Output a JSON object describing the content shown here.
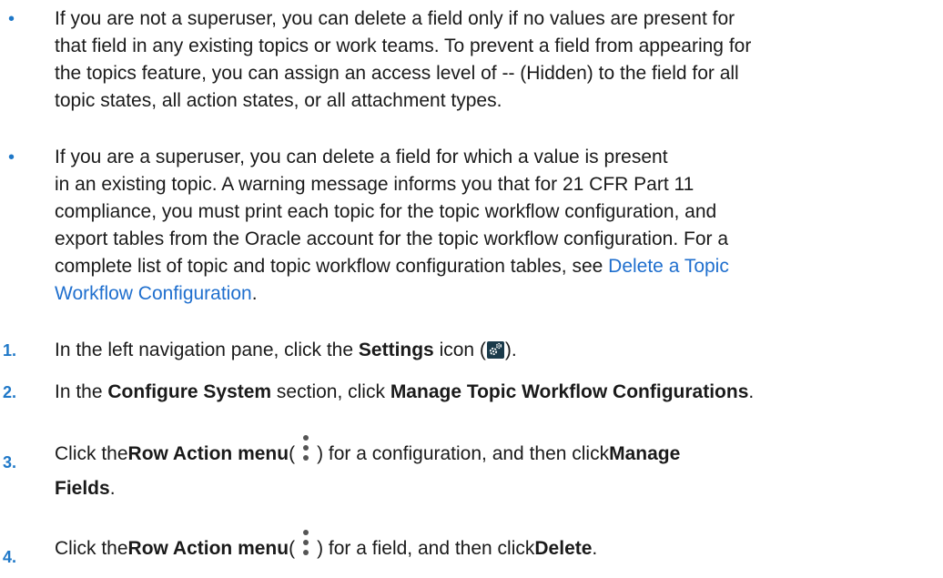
{
  "bullets": [
    {
      "lines": [
        "If you are not a superuser, you can delete a field only if no values are present for",
        "that field in any existing topics or work teams. To prevent a field from appearing for",
        "the topics feature, you can assign an access level of -- (Hidden) to the field for all",
        "topic states, all action states, or all attachment types."
      ]
    },
    {
      "lines": [
        "If you are a superuser, you can delete a field for which a value is present",
        "in an existing topic. A warning message informs you that for 21 CFR Part 11",
        "compliance, you must print each topic for the topic workflow configuration, and",
        "export tables from the Oracle account for the topic workflow configuration. For a"
      ],
      "line5_prefix": "complete list of topic and topic workflow configuration tables, see ",
      "link_line1": "Delete a Topic",
      "link_line2": "Workflow Configuration",
      "link_suffix": "."
    }
  ],
  "steps": [
    {
      "number": "1.",
      "pre": "In the left navigation pane, click the ",
      "bold1": "Settings",
      "mid": " icon (",
      "icon": "settings-gear-icon",
      "post": ")."
    },
    {
      "number": "2.",
      "pre": "In the ",
      "bold1": "Configure System",
      "mid": " section, click ",
      "bold2": "Manage Topic Workflow Configurations",
      "post": "."
    },
    {
      "number": "3.",
      "pre": "Click the ",
      "bold1": "Row Action menu",
      "mid": " (",
      "icon": "kebab-menu-icon",
      "mid2": ") for a configuration, and then click ",
      "bold2": "Manage",
      "line2_bold": "Fields",
      "post": "."
    },
    {
      "number": "4.",
      "pre": "Click the ",
      "bold1": "Row Action menu",
      "mid": " (",
      "icon": "kebab-menu-icon",
      "mid2": ") for a field, and then click ",
      "bold2": "Delete",
      "post": "."
    }
  ],
  "colors": {
    "accent": "#1f78c8",
    "link": "#1f6fce",
    "text": "#1a1a1a"
  }
}
